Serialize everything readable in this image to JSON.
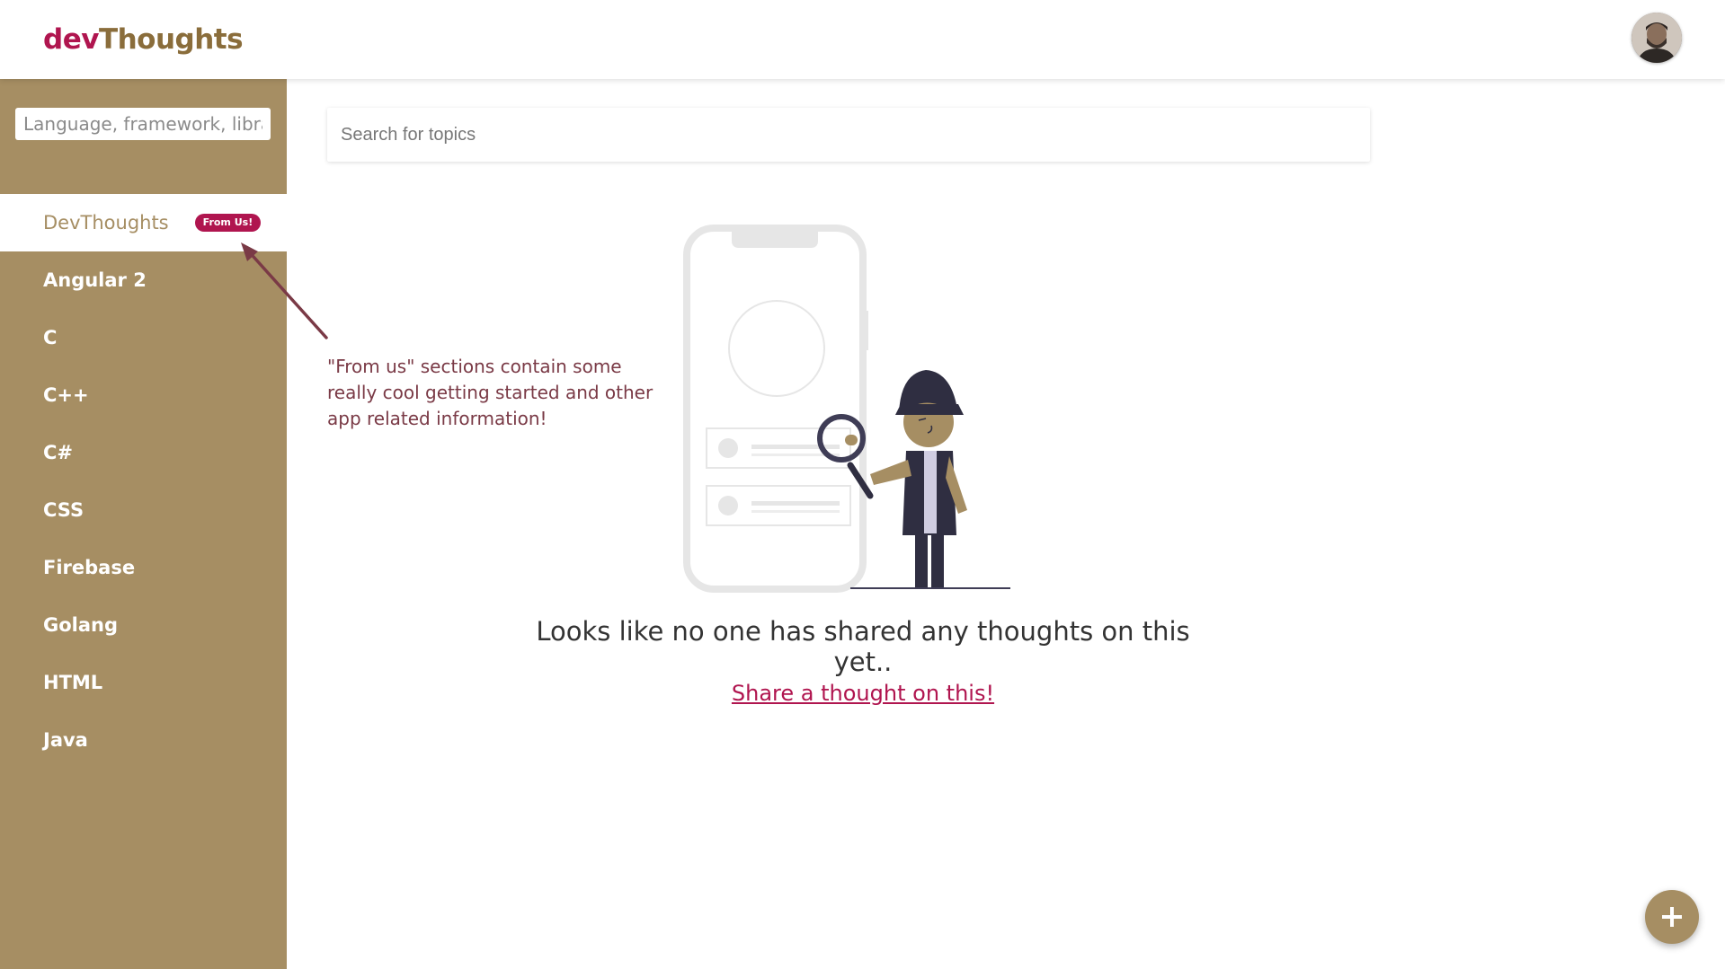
{
  "brand": {
    "dev": "dev",
    "thoughts": "Thoughts"
  },
  "header": {
    "avatar": "user-avatar"
  },
  "sidebar": {
    "search_placeholder": "Language, framework, library",
    "items": [
      {
        "label": "DevThoughts",
        "badge": "From Us!",
        "active": true
      },
      {
        "label": "Angular 2"
      },
      {
        "label": "C"
      },
      {
        "label": "C++"
      },
      {
        "label": "C#"
      },
      {
        "label": "CSS"
      },
      {
        "label": "Firebase"
      },
      {
        "label": "Golang"
      },
      {
        "label": "HTML"
      },
      {
        "label": "Java"
      }
    ]
  },
  "main": {
    "search_placeholder": "Search for topics",
    "annotation": "\"From us\" sections contain some really cool getting started and other app related information!",
    "empty_message": "Looks like no one has shared any thoughts on this yet..",
    "share_link": "Share a thought on this!"
  },
  "fab": {
    "icon": "plus-icon"
  },
  "colors": {
    "sidebar": "#a68e63",
    "accent": "#b0154f",
    "annotation": "#7a3a46",
    "brand_thoughts": "#8a6d3b"
  }
}
